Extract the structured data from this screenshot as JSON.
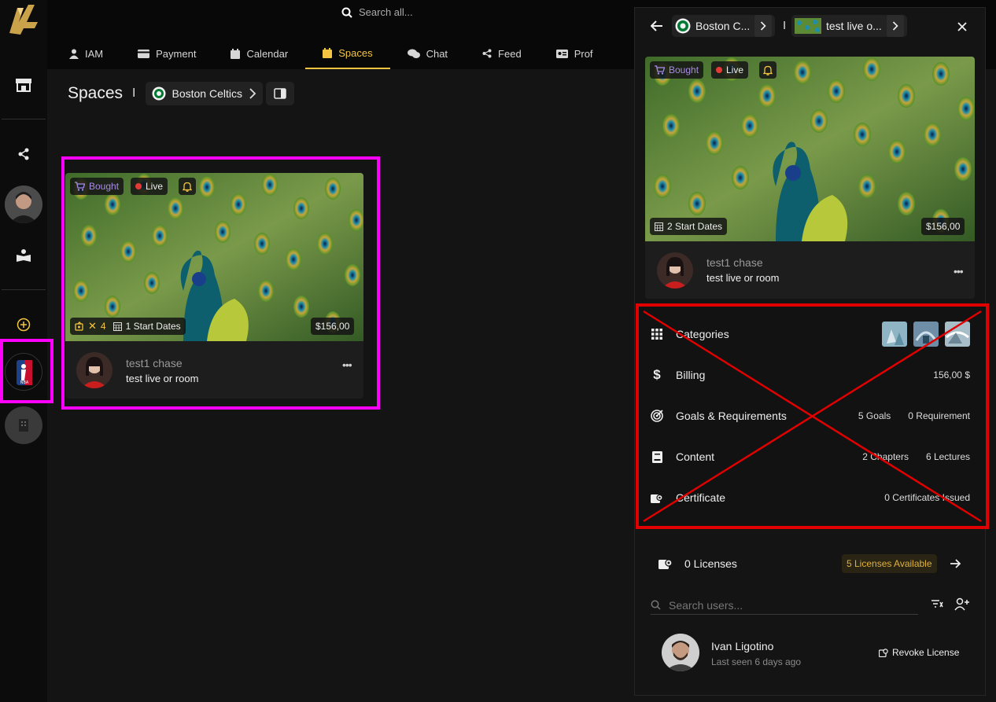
{
  "search": {
    "placeholder": "Search all..."
  },
  "tabs": [
    {
      "label": "IAM",
      "icon": "person-icon"
    },
    {
      "label": "Payment",
      "icon": "card-icon"
    },
    {
      "label": "Calendar",
      "icon": "calendar-icon"
    },
    {
      "label": "Spaces",
      "icon": "spaces-icon",
      "active": true
    },
    {
      "label": "Chat",
      "icon": "chat-icon"
    },
    {
      "label": "Feed",
      "icon": "share-icon"
    },
    {
      "label": "Prof",
      "icon": "profile-card-icon"
    }
  ],
  "main": {
    "title": "Spaces",
    "breadcrumb": "Boston Celtics"
  },
  "card": {
    "badge_bought": "Bought",
    "badge_live": "Live",
    "license_count": "4",
    "start_dates": "1 Start Dates",
    "price": "$156,00",
    "author": "test1 chase",
    "title": "test live or room"
  },
  "panel": {
    "crumb_space": "Boston C...",
    "crumb_item": "test live o...",
    "badge_bought": "Bought",
    "badge_live": "Live",
    "start_dates": "2 Start Dates",
    "price": "$156,00",
    "author": "test1 chase",
    "title": "test live or room",
    "rows": {
      "categories": "Categories",
      "billing": "Billing",
      "billing_value": "156,00 $",
      "goals": "Goals & Requirements",
      "goals_value": "5 Goals",
      "requirements_value": "0 Requirement",
      "content": "Content",
      "chapters_value": "2 Chapters",
      "lectures_value": "6 Lectures",
      "certificate": "Certificate",
      "certificate_value": "0 Certificates Issued"
    },
    "licenses": {
      "label": "0 Licenses",
      "available": "5 Licenses Available"
    },
    "user_search": {
      "placeholder": "Search users..."
    },
    "user": {
      "name": "Ivan Ligotino",
      "last_seen": "Last seen 6 days ago",
      "action": "Revoke License"
    }
  },
  "colors": {
    "accent": "#f5c542",
    "highlight": "#ff00ff",
    "cross": "#e00000",
    "bought": "#a98be6",
    "live_dot": "#e53935"
  }
}
